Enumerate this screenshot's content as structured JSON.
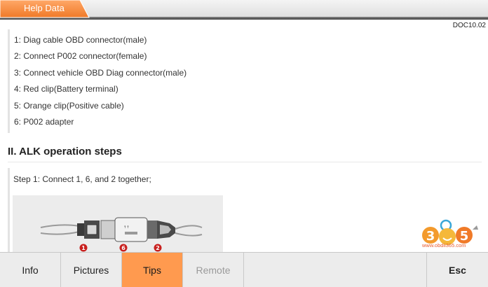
{
  "header": {
    "tab_title": "Help Data",
    "doc_code": "DOC10.02"
  },
  "parts_list": [
    "1: Diag cable OBD connector(male)",
    "2: Connect P002 connector(female)",
    "3: Connect vehicle OBD Diag connector(male)",
    "4: Red clip(Battery terminal)",
    "5: Orange clip(Positive cable)",
    "6: P002 adapter"
  ],
  "section": {
    "title": "II. ALK operation steps",
    "step1": "Step 1: Connect 1, 6, and 2 together;"
  },
  "diagram": {
    "markers": [
      "1",
      "6",
      "2"
    ],
    "marker_color": "#c8201e"
  },
  "watermark": {
    "text": "www.obdii365.com",
    "digits": [
      "3",
      "6",
      "5"
    ]
  },
  "bottom_bar": {
    "buttons": [
      {
        "label": "Info",
        "state": "normal"
      },
      {
        "label": "Pictures",
        "state": "normal"
      },
      {
        "label": "Tips",
        "state": "active"
      },
      {
        "label": "Remote",
        "state": "disabled"
      }
    ],
    "esc_label": "Esc"
  },
  "colors": {
    "accent": "#ff9a4f",
    "tab_orange": "#f58a3c"
  }
}
